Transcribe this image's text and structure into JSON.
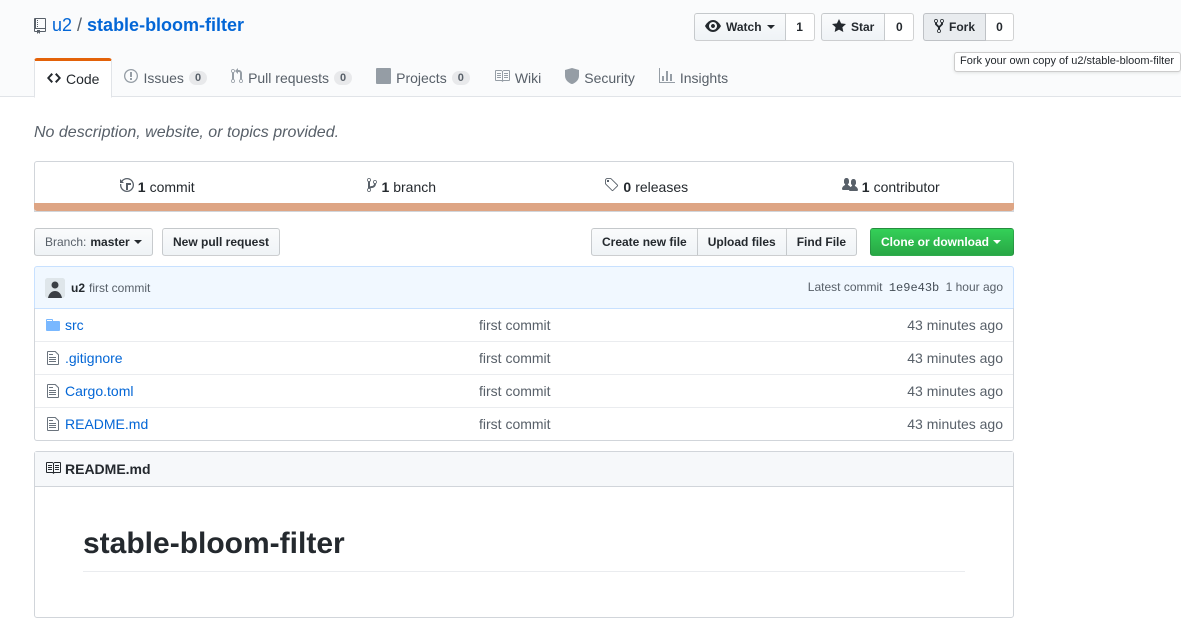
{
  "repo": {
    "owner": "u2",
    "separator": "/",
    "name": "stable-bloom-filter",
    "description": "No description, website, or topics provided."
  },
  "actions": {
    "watch_label": "Watch",
    "watch_count": "1",
    "star_label": "Star",
    "star_count": "0",
    "fork_label": "Fork",
    "fork_count": "0",
    "fork_tooltip": "Fork your own copy of u2/stable-bloom-filter"
  },
  "tabs": [
    {
      "label": "Code",
      "counter": null
    },
    {
      "label": "Issues",
      "counter": "0"
    },
    {
      "label": "Pull requests",
      "counter": "0"
    },
    {
      "label": "Projects",
      "counter": "0"
    },
    {
      "label": "Wiki",
      "counter": null
    },
    {
      "label": "Security",
      "counter": null
    },
    {
      "label": "Insights",
      "counter": null
    }
  ],
  "summary": {
    "commits_count": "1",
    "commits_label": "commit",
    "branches_count": "1",
    "branches_label": "branch",
    "releases_count": "0",
    "releases_label": "releases",
    "contributors_count": "1",
    "contributors_label": "contributor"
  },
  "language_color": "#dea584",
  "filebar": {
    "branch_prefix": "Branch:",
    "branch_name": "master",
    "new_pr": "New pull request",
    "create_file": "Create new file",
    "upload_files": "Upload files",
    "find_file": "Find File",
    "clone": "Clone or download"
  },
  "latest_commit": {
    "author": "u2",
    "message": "first commit",
    "prefix": "Latest commit",
    "sha": "1e9e43b",
    "age": "1 hour ago"
  },
  "files": [
    {
      "name": "src",
      "type": "folder",
      "message": "first commit",
      "age": "43 minutes ago"
    },
    {
      "name": ".gitignore",
      "type": "file",
      "message": "first commit",
      "age": "43 minutes ago"
    },
    {
      "name": "Cargo.toml",
      "type": "file",
      "message": "first commit",
      "age": "43 minutes ago"
    },
    {
      "name": "README.md",
      "type": "file",
      "message": "first commit",
      "age": "43 minutes ago"
    }
  ],
  "readme": {
    "filename": "README.md",
    "heading": "stable-bloom-filter"
  }
}
